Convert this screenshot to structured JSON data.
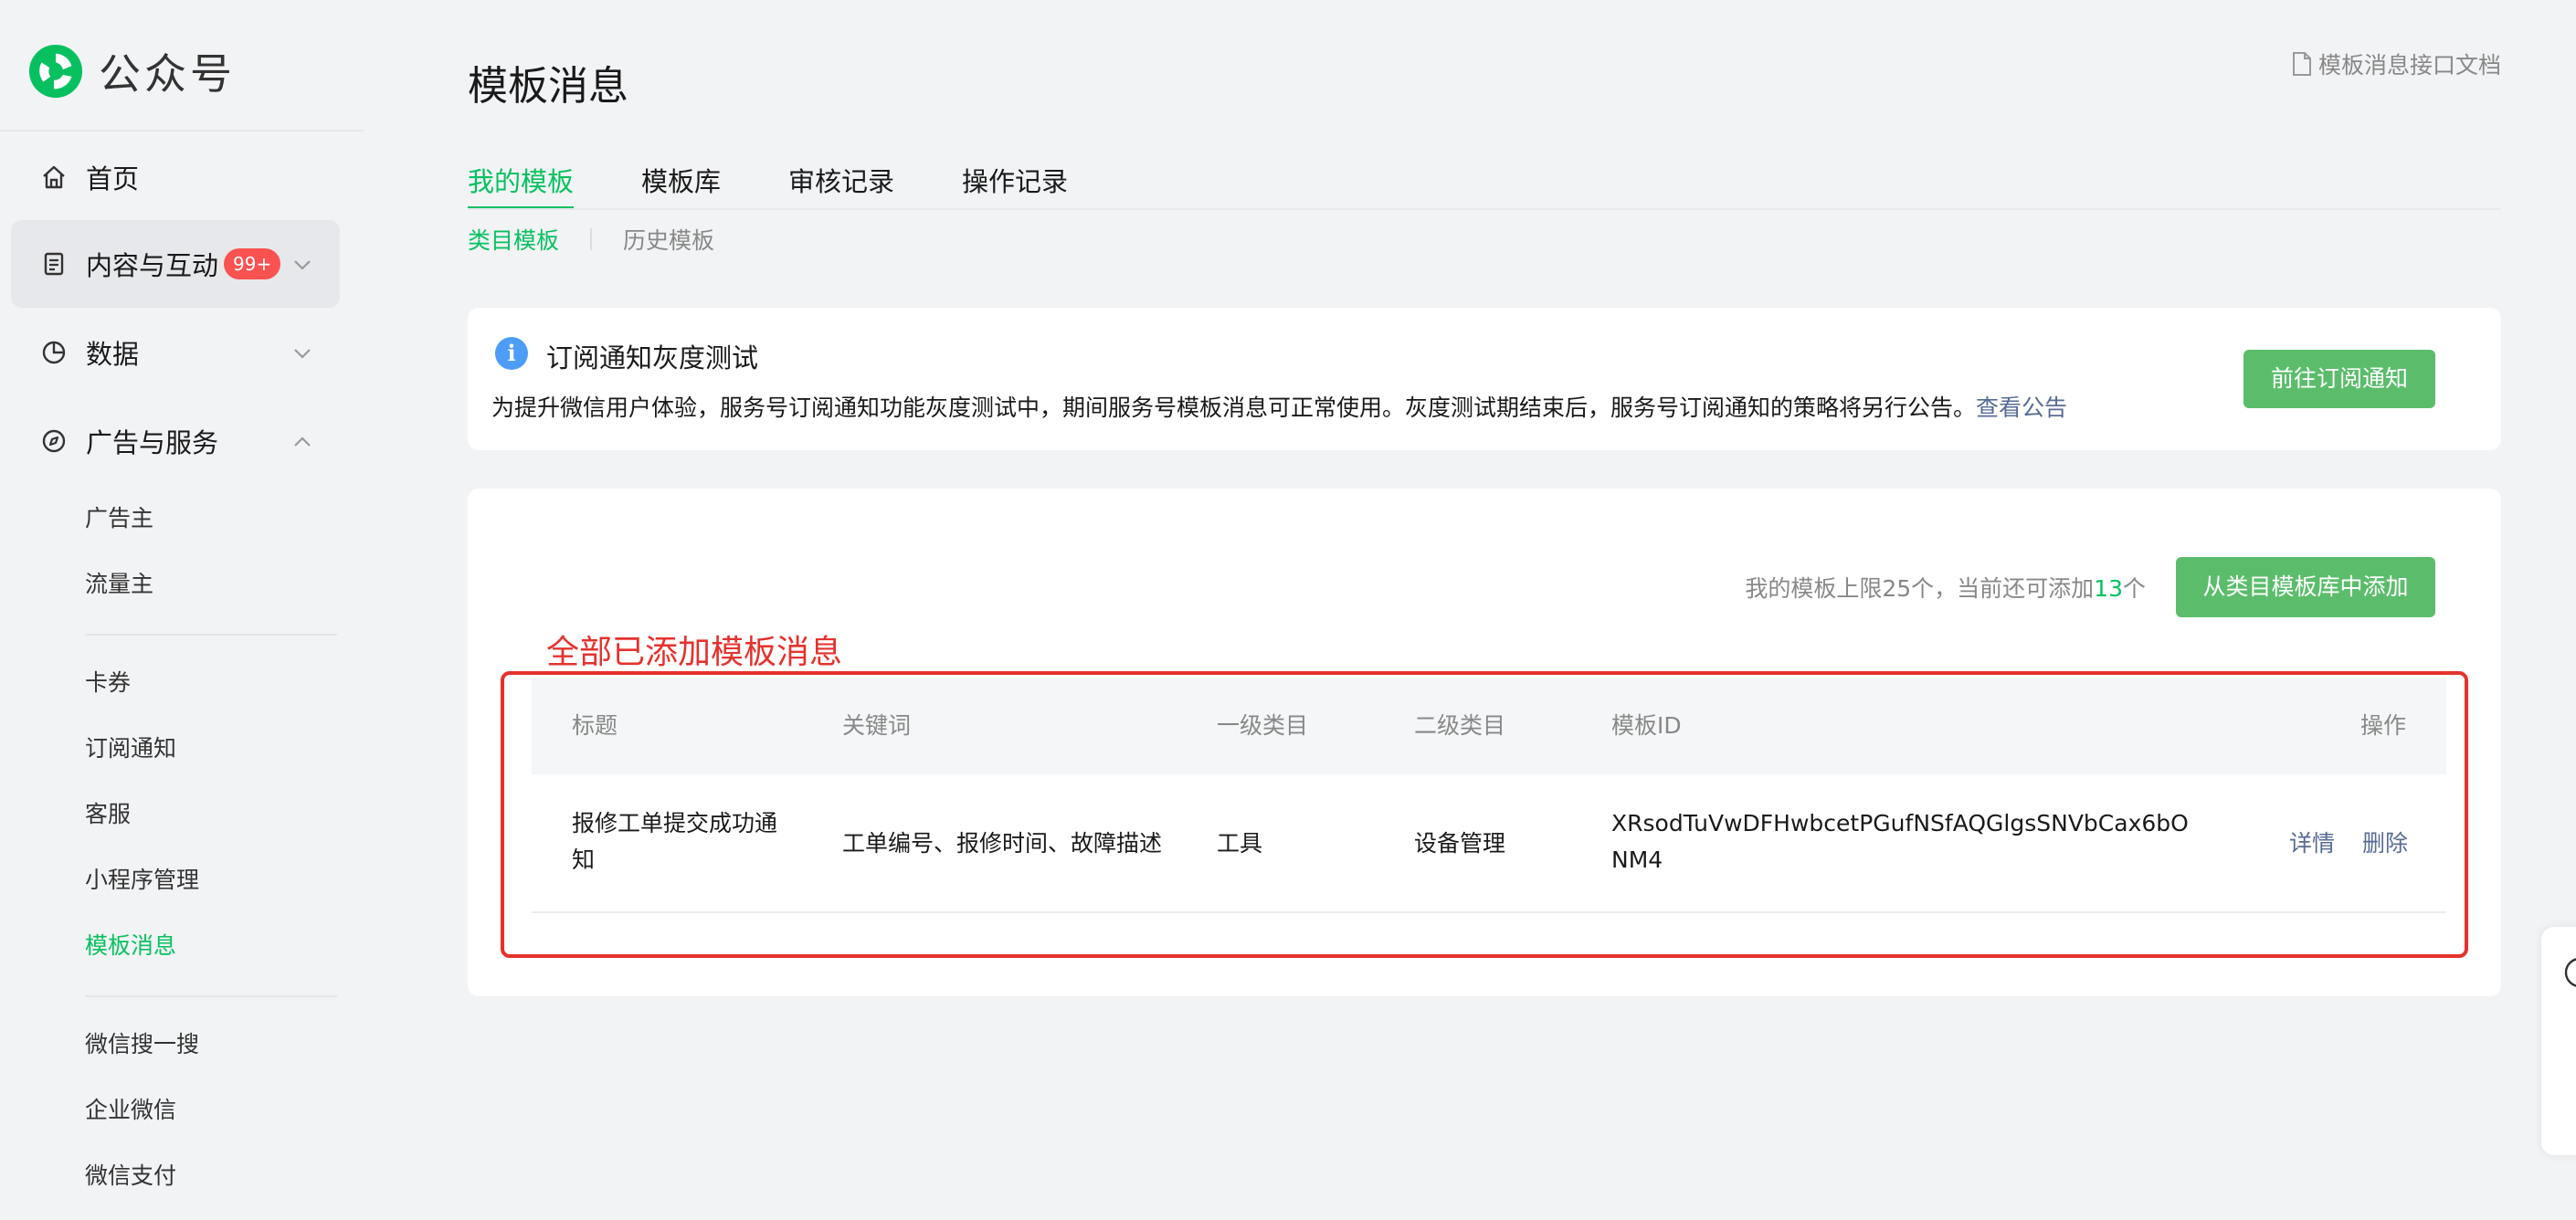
{
  "brand": {
    "name": "公众号"
  },
  "sidebar": {
    "nav": [
      {
        "label": "首页",
        "icon": "home-icon"
      },
      {
        "label": "内容与互动",
        "icon": "document-icon",
        "badge": "99+"
      },
      {
        "label": "数据",
        "icon": "pie-chart-icon"
      },
      {
        "label": "广告与服务",
        "icon": "compass-icon"
      }
    ],
    "sub_items": [
      "广告主",
      "流量主",
      "卡券",
      "订阅通知",
      "客服",
      "小程序管理",
      "模板消息",
      "微信搜一搜",
      "企业微信",
      "微信支付"
    ],
    "current_sub": "模板消息"
  },
  "main": {
    "title": "模板消息",
    "doc_link": "模板消息接口文档",
    "tabs": [
      "我的模板",
      "模板库",
      "审核记录",
      "操作记录"
    ],
    "subtabs": [
      "类目模板",
      "历史模板"
    ]
  },
  "notice": {
    "title": "订阅通知灰度测试",
    "body": "为提升微信用户体验，服务号订阅通知功能灰度测试中，期间服务号模板消息可正常使用。灰度测试期结束后，服务号订阅通知的策略将另行公告。",
    "link": "查看公告",
    "button": "前往订阅通知"
  },
  "template_list": {
    "quota_prefix": "我的模板上限25个，当前还可添加",
    "quota_remaining": "13",
    "quota_suffix": "个",
    "add_button": "从类目模板库中添加",
    "annotation": "全部已添加模板消息",
    "columns": [
      "标题",
      "关键词",
      "一级类目",
      "二级类目",
      "模板ID",
      "操作"
    ],
    "rows": [
      {
        "title_line1": "报修工单提交成功通",
        "title_line2": "知",
        "keywords": "工单编号、报修时间、故障描述",
        "category1": "工具",
        "category2": "设备管理",
        "template_id_line1": "XRsodTuVwDFHwbcetPGufNSfAQGlgsSNVbCax6bO",
        "template_id_line2": "NM4",
        "op_detail": "详情",
        "op_delete": "删除"
      }
    ]
  },
  "colors": {
    "accent": "#07c160",
    "button": "#5bbd6b",
    "link": "#576b95",
    "annotation": "#e5322d",
    "badge": "#fa5151",
    "info": "#4d9df7"
  }
}
